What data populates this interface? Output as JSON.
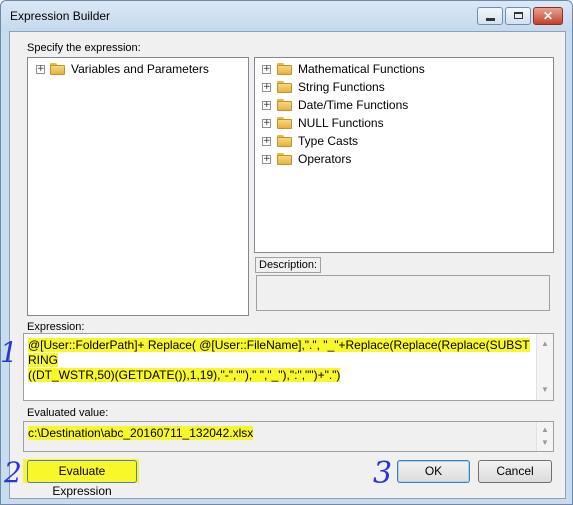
{
  "window": {
    "title": "Expression Builder",
    "minimize_glyph": "",
    "maximize_glyph": "",
    "close_glyph": "✕"
  },
  "labels": {
    "specify": "Specify the expression:",
    "description": "Description:",
    "expression": "Expression:",
    "evaluated_value": "Evaluated value:"
  },
  "left_tree": [
    {
      "label": "Variables and Parameters",
      "expander": "+",
      "icon": "folder-icon"
    }
  ],
  "right_tree": [
    {
      "label": "Mathematical Functions",
      "expander": "+",
      "icon": "folder-icon"
    },
    {
      "label": "String Functions",
      "expander": "+",
      "icon": "folder-icon"
    },
    {
      "label": "Date/Time Functions",
      "expander": "+",
      "icon": "folder-icon"
    },
    {
      "label": "NULL Functions",
      "expander": "+",
      "icon": "folder-icon"
    },
    {
      "label": "Type Casts",
      "expander": "+",
      "icon": "folder-icon"
    },
    {
      "label": "Operators",
      "expander": "+",
      "icon": "folder-icon"
    }
  ],
  "expression": {
    "line1": "@[User::FolderPath]+ Replace( @[User::FileName],\".\", \"_\"+Replace(Replace(Replace(SUBSTRING",
    "line2": "((DT_WSTR,50)(GETDATE()),1,19),\"-\",\"\"),\" \",\"_\"),\":\",\"\")+\".\")"
  },
  "evaluated": {
    "value": "c:\\Destination\\abc_20160711_132042.xlsx"
  },
  "buttons": {
    "evaluate": "Evaluate Expression",
    "ok": "OK",
    "cancel": "Cancel"
  },
  "scroll_arrows": {
    "up": "▲",
    "down": "▼"
  },
  "annotations": {
    "one": "1",
    "two": "2",
    "three": "3"
  },
  "colors": {
    "highlight": "#f8f72a",
    "annotation_ink": "#2a36d6"
  }
}
